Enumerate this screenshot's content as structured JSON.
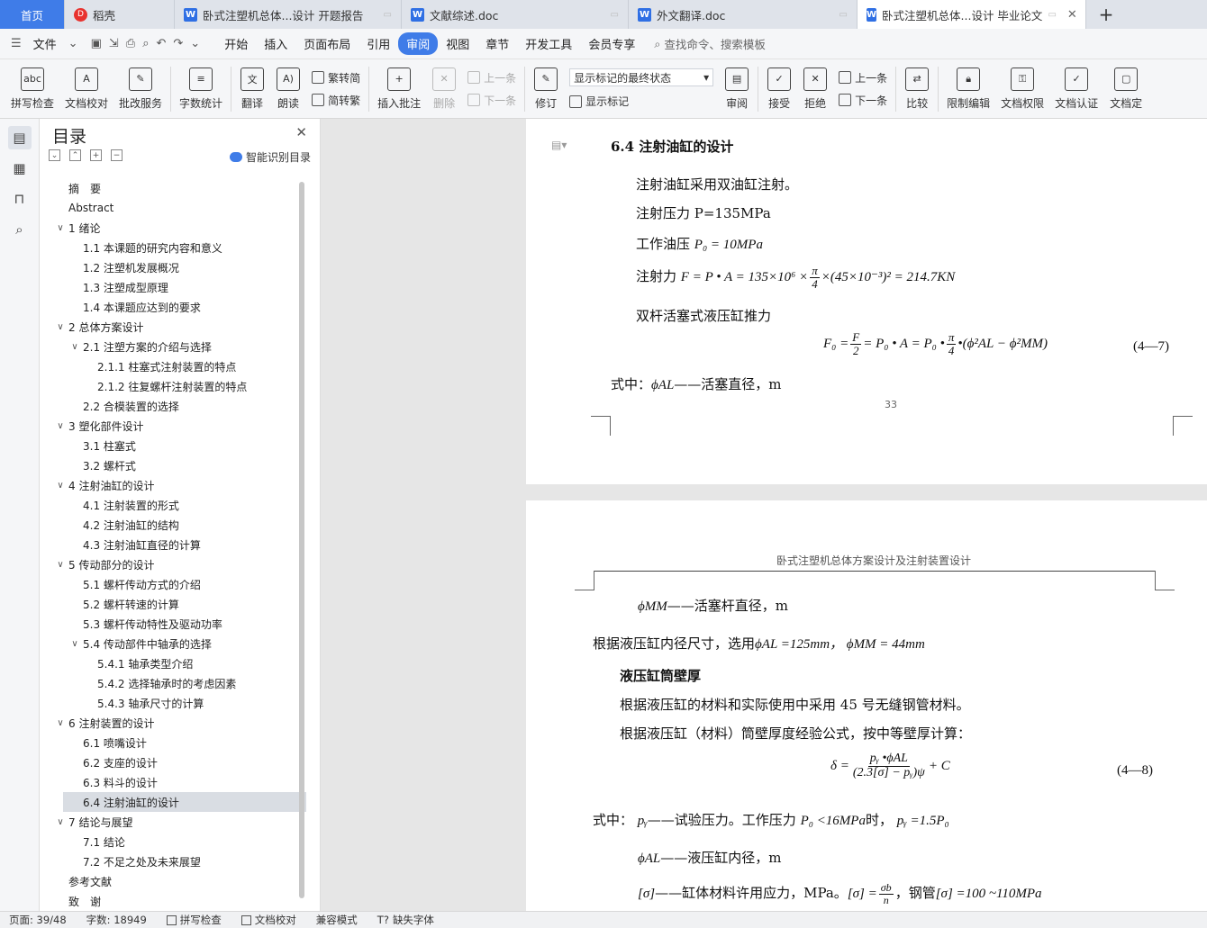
{
  "tabs": [
    {
      "label": "首页",
      "type": "home"
    },
    {
      "label": "稻壳",
      "type": "docer"
    },
    {
      "label": "卧式注塑机总体...设计 开题报告",
      "type": "doc"
    },
    {
      "label": "文献综述.doc",
      "type": "doc"
    },
    {
      "label": "外文翻译.doc",
      "type": "doc"
    },
    {
      "label": "卧式注塑机总体...设计 毕业论文",
      "type": "doc",
      "active": true
    }
  ],
  "menu": {
    "file": "文件",
    "items": [
      "开始",
      "插入",
      "页面布局",
      "引用",
      "审阅",
      "视图",
      "章节",
      "开发工具",
      "会员专享"
    ],
    "active": "审阅",
    "search": "查找命令、搜索模板"
  },
  "ribbon": {
    "spell": "拼写检查",
    "proof": "文档校对",
    "batch": "批改服务",
    "wordcount": "字数统计",
    "translate": "翻译",
    "read": "朗读",
    "trad": "繁转简",
    "simp": "简转繁",
    "insert_comment": "插入批注",
    "delete": "删除",
    "prev": "上一条",
    "next": "下一条",
    "revise": "修订",
    "markup_state": "显示标记的最终状态",
    "show_markup": "显示标记",
    "review": "审阅",
    "accept": "接受",
    "reject": "拒绝",
    "prev2": "上一条",
    "next2": "下一条",
    "compare": "比较",
    "restrict": "限制编辑",
    "rights": "文档权限",
    "certify": "文档认证",
    "doc_cut": "文档定"
  },
  "toc": {
    "title": "目录",
    "smart": "智能识别目录",
    "items": [
      {
        "label": "摘　要",
        "level": 0,
        "chev": ""
      },
      {
        "label": "Abstract",
        "level": 0,
        "chev": ""
      },
      {
        "label": "1  绪论",
        "level": 0,
        "chev": "v"
      },
      {
        "label": "1.1  本课题的研究内容和意义",
        "level": 1,
        "chev": ""
      },
      {
        "label": "1.2  注塑机发展概况",
        "level": 1,
        "chev": ""
      },
      {
        "label": "1.3  注塑成型原理",
        "level": 1,
        "chev": ""
      },
      {
        "label": "1.4 本课题应达到的要求",
        "level": 1,
        "chev": ""
      },
      {
        "label": "2  总体方案设计",
        "level": 0,
        "chev": "v"
      },
      {
        "label": "2.1 注塑方案的介绍与选择",
        "level": 1,
        "chev": "v"
      },
      {
        "label": "2.1.1 柱塞式注射装置的特点",
        "level": 2,
        "chev": ""
      },
      {
        "label": "2.1.2 往复螺杆注射装置的特点",
        "level": 2,
        "chev": ""
      },
      {
        "label": "2.2 合模装置的选择",
        "level": 1,
        "chev": ""
      },
      {
        "label": "3  塑化部件设计",
        "level": 0,
        "chev": "v"
      },
      {
        "label": "3.1  柱塞式",
        "level": 1,
        "chev": ""
      },
      {
        "label": "3.2  螺杆式",
        "level": 1,
        "chev": ""
      },
      {
        "label": "4  注射油缸的设计",
        "level": 0,
        "chev": "v"
      },
      {
        "label": "4.1  注射装置的形式",
        "level": 1,
        "chev": ""
      },
      {
        "label": "4.2  注射油缸的结构",
        "level": 1,
        "chev": ""
      },
      {
        "label": "4.3  注射油缸直径的计算",
        "level": 1,
        "chev": ""
      },
      {
        "label": "5  传动部分的设计",
        "level": 0,
        "chev": "v"
      },
      {
        "label": "5.1  螺杆传动方式的介绍",
        "level": 1,
        "chev": ""
      },
      {
        "label": "5.2  螺杆转速的计算",
        "level": 1,
        "chev": ""
      },
      {
        "label": "5.3  螺杆传动特性及驱动功率",
        "level": 1,
        "chev": ""
      },
      {
        "label": "5.4 传动部件中轴承的选择",
        "level": 1,
        "chev": "v"
      },
      {
        "label": "5.4.1  轴承类型介绍",
        "level": 2,
        "chev": ""
      },
      {
        "label": "5.4.2  选择轴承时的考虑因素",
        "level": 2,
        "chev": ""
      },
      {
        "label": "5.4.3  轴承尺寸的计算",
        "level": 2,
        "chev": ""
      },
      {
        "label": "6  注射装置的设计",
        "level": 0,
        "chev": "v"
      },
      {
        "label": "6.1  喷嘴设计",
        "level": 1,
        "chev": ""
      },
      {
        "label": "6.2  支座的设计",
        "level": 1,
        "chev": ""
      },
      {
        "label": "6.3  料斗的设计",
        "level": 1,
        "chev": ""
      },
      {
        "label": "6.4 注射油缸的设计",
        "level": 1,
        "chev": "",
        "selected": true
      },
      {
        "label": "7  结论与展望",
        "level": 0,
        "chev": "v"
      },
      {
        "label": "7.1 结论",
        "level": 1,
        "chev": ""
      },
      {
        "label": "7.2 不足之处及未来展望",
        "level": 1,
        "chev": ""
      },
      {
        "label": "参考文献",
        "level": 0,
        "chev": ""
      },
      {
        "label": "致　谢",
        "level": 0,
        "chev": ""
      }
    ]
  },
  "page1": {
    "heading": "6.4  注射油缸的设计",
    "l1": "注射油缸采用双油缸注射。",
    "l2": "注射压力 P=135MPa",
    "l3a": "工作油压",
    "l3m": "P₀ = 10MPa",
    "l4a": "注射力",
    "l4m1": "F = P • A = 135×10⁶ ×",
    "l4fn": "π",
    "l4fd": "4",
    "l4m2": "×(45×10⁻³)² = 214.7KN",
    "l5": "双杆活塞式液压缸推力",
    "eq1a": "F₀ =",
    "eq1fn": "F",
    "eq1fd": "2",
    "eq1b": "= P₀ • A = P₀ •",
    "eq1gn": "π",
    "eq1gd": "4",
    "eq1c": "•(ϕ²AL − ϕ²MM)",
    "eq1no": "(4—7)",
    "l6a": "式中：",
    "l6m": "ϕAL",
    "l6b": "——活塞直径，m",
    "pagenum": "33"
  },
  "page2": {
    "header": "卧式注塑机总体方案设计及注射装置设计",
    "l1m": "ϕMM",
    "l1b": "——活塞杆直径，m",
    "l2a": "根据液压缸内径尺寸，选用",
    "l2m": "ϕAL =125mm，  ϕMM = 44mm",
    "h2": "液压缸筒壁厚",
    "l3": "根据液压缸的材料和实际使用中采用 45 号无缝钢管材料。",
    "l4": "根据液压缸（材料）筒壁厚度经验公式，按中等壁厚计算：",
    "eq2a": "δ =",
    "eq2n": "pᵧ •ϕAL",
    "eq2d": "(2.3[σ] − pᵧ)ψ",
    "eq2b": "+ C",
    "eq2no": "(4—8)",
    "l5a": "式中：",
    "l5m1": "pᵧ",
    "l5b": "——试验压力。工作压力",
    "l5m2": "P₀ <16MPa",
    "l5c": "时，",
    "l5m3": "pᵧ =1.5P₀",
    "l6m": "ϕAL",
    "l6b": "——液压缸内径，m",
    "l7m1": "[σ]",
    "l7b": "——缸体材料许用应力，MPa。",
    "l7m2": "[σ] =",
    "l7fn": "σb",
    "l7fd": "n",
    "l7c": "，钢管",
    "l7m3": "[σ] =100 ~110MPa"
  },
  "status": {
    "page": "页面: 39/48",
    "words": "字数: 18949",
    "spell": "拼写检查",
    "proof": "文档校对",
    "compat": "兼容模式",
    "font": "缺失字体"
  }
}
